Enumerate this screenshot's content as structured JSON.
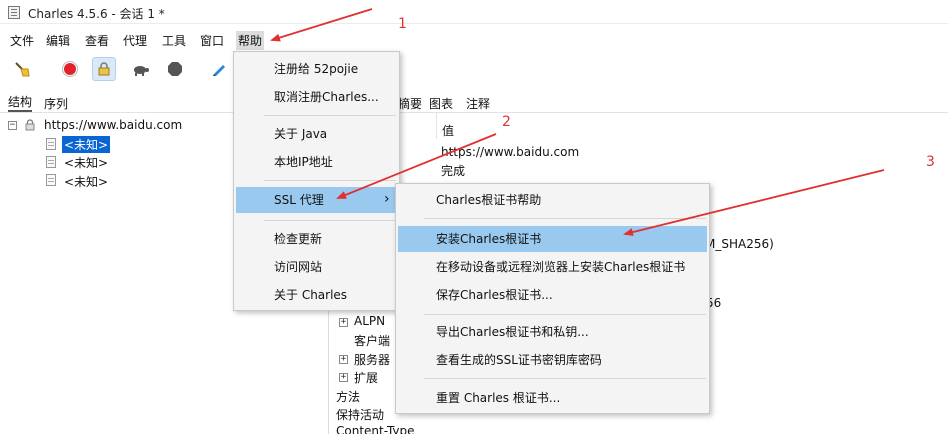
{
  "window": {
    "title": "Charles 4.5.6 - 会话 1 *"
  },
  "menubar": {
    "items": [
      "文件",
      "编辑",
      "查看",
      "代理",
      "工具",
      "窗口",
      "帮助"
    ]
  },
  "toolbar": {
    "buttons": [
      "broom-icon",
      "record-icon",
      "ssl-lock-icon",
      "turtle-icon",
      "stop-icon",
      "pen-icon"
    ]
  },
  "left_panel": {
    "tabs": [
      "结构",
      "序列"
    ],
    "tree": {
      "host": "https://www.baidu.com",
      "children": [
        "<未知>",
        "<未知>",
        "<未知>"
      ]
    }
  },
  "right_panel": {
    "tabs": [
      "摘要",
      "图表",
      "注释"
    ],
    "value_header": "值",
    "values": [
      "https://www.baidu.com",
      "完成"
    ],
    "partial_texts": [
      "M_SHA256)",
      "56"
    ],
    "rows": [
      "ALPN",
      "客户端",
      "服务器",
      "扩展",
      "方法",
      "保持活动",
      "Content-Type"
    ]
  },
  "help_menu": {
    "items": [
      "注册给 52pojie",
      "取消注册Charles...",
      "关于 Java",
      "本地IP地址",
      "SSL 代理",
      "检查更新",
      "访问网站",
      "关于 Charles"
    ],
    "submenu_arrow": "›"
  },
  "ssl_submenu": {
    "items": [
      "Charles根证书帮助",
      "安装Charles根证书",
      "在移动设备或远程浏览器上安装Charles根证书",
      "保存Charles根证书...",
      "导出Charles根证书和私钥...",
      "查看生成的SSL证书密钥库密码",
      "重置 Charles 根证书..."
    ]
  },
  "annotations": {
    "labels": [
      "1",
      "2",
      "3"
    ],
    "color": "#e03030"
  },
  "colors": {
    "highlight": "#99c9ef",
    "selection": "#0a64d2",
    "accent_red": "#e03030"
  }
}
